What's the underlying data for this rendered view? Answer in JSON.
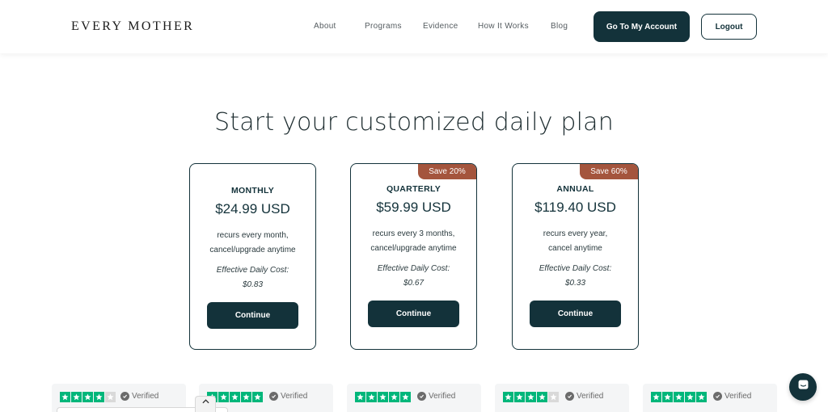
{
  "header": {
    "logo": "EVERY MOTHER",
    "nav": [
      "About",
      "Programs",
      "Evidence",
      "How It Works",
      "Blog"
    ],
    "account_button": "Go To My Account",
    "logout_button": "Logout"
  },
  "headline": "Start your customized daily plan",
  "plans": [
    {
      "badge": "",
      "name": "MONTHLY",
      "price": "$24.99 USD",
      "desc_line1": "recurs every month,",
      "desc_line2": "cancel/upgrade anytime",
      "eff_label": "Effective Daily Cost:",
      "eff_value": "$0.83",
      "button": "Continue"
    },
    {
      "badge": "Save 20%",
      "name": "QUARTERLY",
      "price": "$59.99 USD",
      "desc_line1": "recurs every 3 months,",
      "desc_line2": "cancel/upgrade anytime",
      "eff_label": "Effective Daily Cost:",
      "eff_value": "$0.67",
      "button": "Continue"
    },
    {
      "badge": "Save 60%",
      "name": "ANNUAL",
      "price": "$119.40 USD",
      "desc_line1": "recurs every year,",
      "desc_line2": "cancel anytime",
      "eff_label": "Effective Daily Cost:",
      "eff_value": "$0.33",
      "button": "Continue"
    }
  ],
  "reviews": [
    {
      "stars": 4,
      "label": "Verified"
    },
    {
      "stars": 5,
      "label": "Verified"
    },
    {
      "stars": 5,
      "label": "Verified"
    },
    {
      "stars": 4,
      "label": "Verified"
    },
    {
      "stars": 5,
      "label": "Verified"
    }
  ],
  "colors": {
    "primary": "#13323a",
    "badge": "#a4553d",
    "trustpilot": "#00b67a"
  },
  "icons": {
    "chat": "chat-icon",
    "scroll_up": "chevron-up-icon",
    "star": "star-icon",
    "verified": "check-circle-icon"
  }
}
